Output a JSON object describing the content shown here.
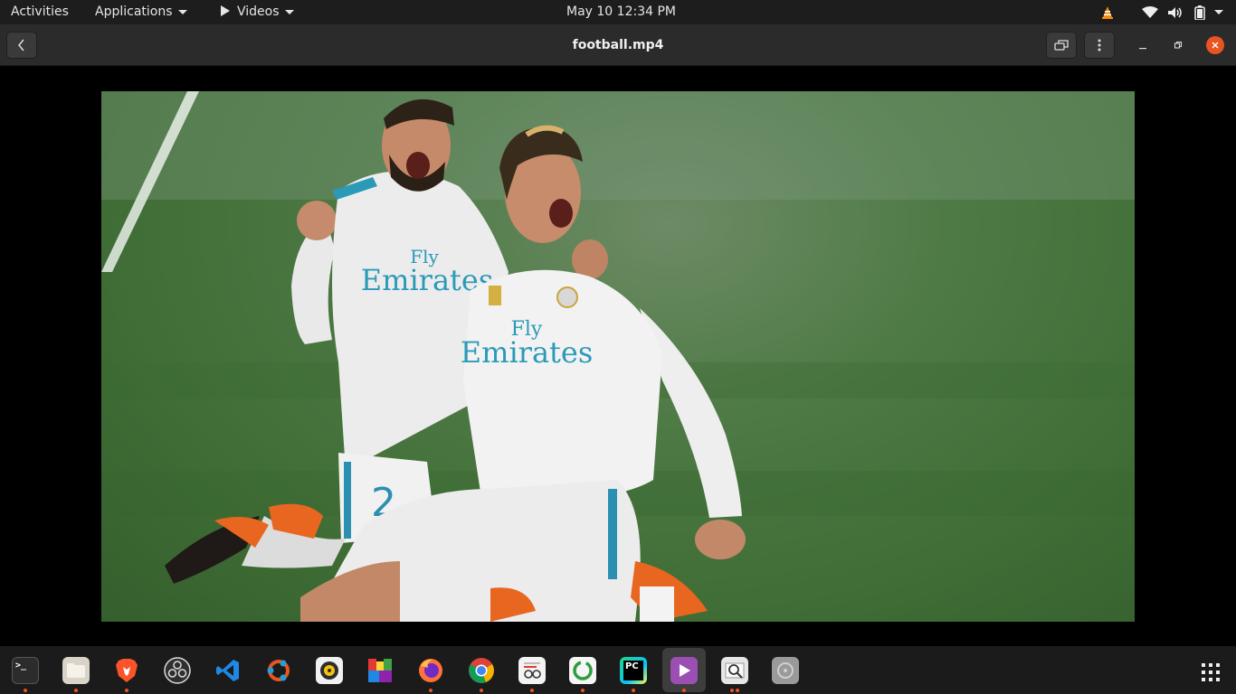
{
  "topbar": {
    "activities": "Activities",
    "applications": "Applications",
    "app_menu": "Videos",
    "clock": "May 10  12:34 PM"
  },
  "window": {
    "title": "football.mp4"
  },
  "video": {
    "jersey_sponsor_fly": "Fly",
    "jersey_sponsor": "Emirates",
    "player_number": "2"
  },
  "dock": {
    "items": [
      {
        "name": "terminal-icon",
        "glyph": ">_"
      },
      {
        "name": "files-icon",
        "glyph": ""
      },
      {
        "name": "brave-icon",
        "glyph": ""
      },
      {
        "name": "obs-icon",
        "glyph": ""
      },
      {
        "name": "vscode-icon",
        "glyph": ""
      },
      {
        "name": "ubuntu-software-icon",
        "glyph": ""
      },
      {
        "name": "rhythmbox-icon",
        "glyph": ""
      },
      {
        "name": "multicolor-app-icon",
        "glyph": ""
      },
      {
        "name": "firefox-icon",
        "glyph": ""
      },
      {
        "name": "chrome-icon",
        "glyph": ""
      },
      {
        "name": "document-viewer-icon",
        "glyph": ""
      },
      {
        "name": "green-circle-app-icon",
        "glyph": ""
      },
      {
        "name": "pycharm-icon",
        "glyph": "PC"
      },
      {
        "name": "videos-icon",
        "glyph": ""
      },
      {
        "name": "image-viewer-icon",
        "glyph": ""
      },
      {
        "name": "disk-icon",
        "glyph": ""
      }
    ]
  }
}
